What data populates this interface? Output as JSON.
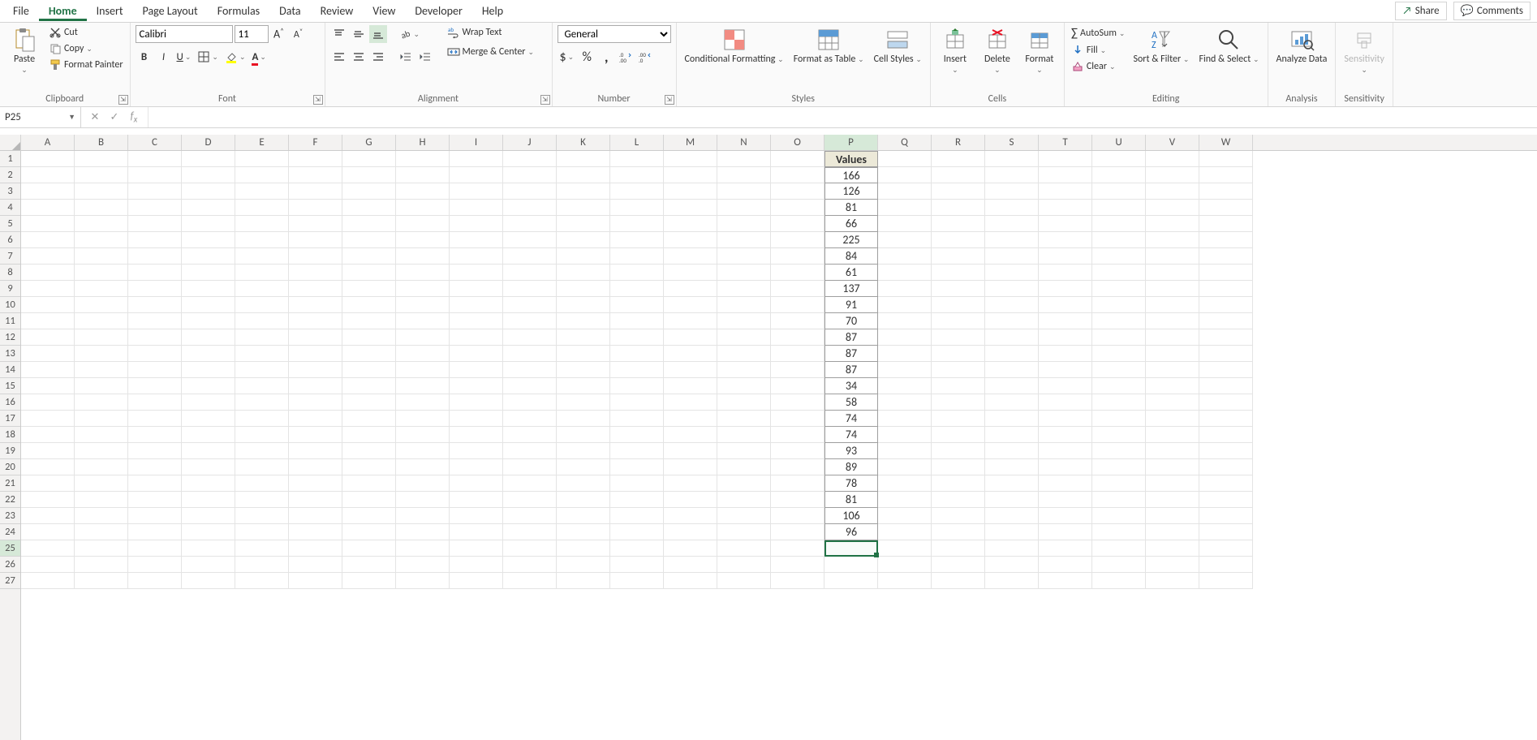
{
  "tabs": {
    "items": [
      "File",
      "Home",
      "Insert",
      "Page Layout",
      "Formulas",
      "Data",
      "Review",
      "View",
      "Developer",
      "Help"
    ],
    "active": 1
  },
  "titlebar": {
    "share": "Share",
    "comments": "Comments"
  },
  "ribbon": {
    "clipboard": {
      "label": "Clipboard",
      "paste": "Paste",
      "cut": "Cut",
      "copy": "Copy",
      "fmtpainter": "Format Painter"
    },
    "font": {
      "label": "Font",
      "name": "Calibri",
      "size": "11"
    },
    "alignment": {
      "label": "Alignment",
      "wrap": "Wrap Text",
      "merge": "Merge & Center"
    },
    "number": {
      "label": "Number",
      "format": "General"
    },
    "styles": {
      "label": "Styles",
      "cond": "Conditional Formatting",
      "fmtas": "Format as Table",
      "cellstyles": "Cell Styles"
    },
    "cells": {
      "label": "Cells",
      "insert": "Insert",
      "delete": "Delete",
      "format": "Format"
    },
    "editing": {
      "label": "Editing",
      "autosum": "AutoSum",
      "fill": "Fill",
      "clear": "Clear",
      "sort": "Sort & Filter",
      "find": "Find & Select"
    },
    "analysis": {
      "label": "Analysis",
      "analyze": "Analyze Data"
    },
    "sensitivity": {
      "label": "Sensitivity",
      "btn": "Sensitivity"
    }
  },
  "formula_bar": {
    "name": "P25",
    "value": ""
  },
  "grid": {
    "columns": [
      "A",
      "B",
      "C",
      "D",
      "E",
      "F",
      "G",
      "H",
      "I",
      "J",
      "K",
      "L",
      "M",
      "N",
      "O",
      "P",
      "Q",
      "R",
      "S",
      "T",
      "U",
      "V",
      "W"
    ],
    "rows": 27,
    "active_cell": {
      "col": "P",
      "row": 25,
      "colIndex": 15,
      "rowIndex": 24
    },
    "data_col": "P",
    "header_text": "Values",
    "values": [
      166,
      126,
      81,
      66,
      225,
      84,
      61,
      137,
      91,
      70,
      87,
      87,
      87,
      34,
      58,
      74,
      74,
      93,
      89,
      78,
      81,
      106,
      96
    ]
  }
}
